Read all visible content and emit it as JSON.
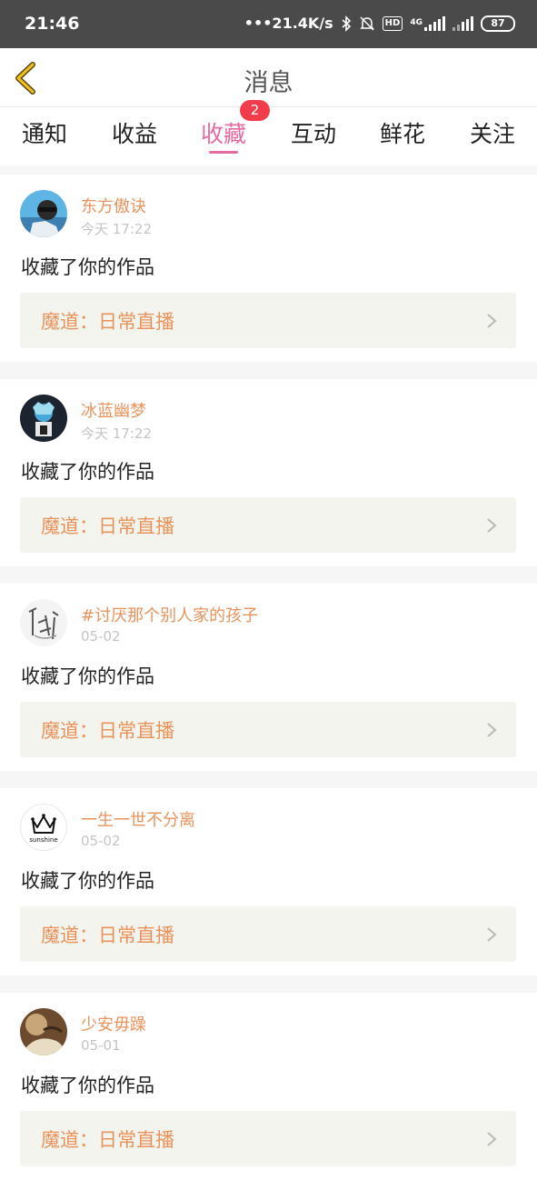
{
  "status_bar": {
    "time": "21:46",
    "network_speed": "•••21.4K/s",
    "icons": [
      "bluetooth-icon",
      "mute-bell-icon",
      "hd-icon",
      "4g-signal-icon",
      "signal-icon"
    ],
    "hd": "HD",
    "net_type": "4G",
    "battery": "87"
  },
  "header": {
    "title": "消息",
    "back_icon": "chevron-left-icon"
  },
  "tabs": [
    {
      "label": "通知"
    },
    {
      "label": "收益"
    },
    {
      "label": "收藏",
      "active": true,
      "badge": "2"
    },
    {
      "label": "互动"
    },
    {
      "label": "鲜花"
    },
    {
      "label": "关注"
    }
  ],
  "messages": [
    {
      "username": "东方傲诀",
      "time": "今天 17:22",
      "action": "收藏了你的作品",
      "work_title": "魔道：日常直播"
    },
    {
      "username": "冰蓝幽梦",
      "time": "今天 17:22",
      "action": "收藏了你的作品",
      "work_title": "魔道：日常直播"
    },
    {
      "username": "#讨厌那个别人家的孩子",
      "time": "05-02",
      "action": "收藏了你的作品",
      "work_title": "魔道：日常直播"
    },
    {
      "username": "一生一世不分离",
      "time": "05-02",
      "action": "收藏了你的作品",
      "work_title": "魔道：日常直播",
      "avatar_text": "sunshine"
    },
    {
      "username": "少安毋躁",
      "time": "05-01",
      "action": "收藏了你的作品",
      "work_title": "魔道：日常直播"
    }
  ],
  "colors": {
    "accent_pink": "#e46aa2",
    "username_orange": "#e8935c",
    "badge_red": "#f03c4b",
    "status_bar_bg": "#4a4a4a"
  }
}
